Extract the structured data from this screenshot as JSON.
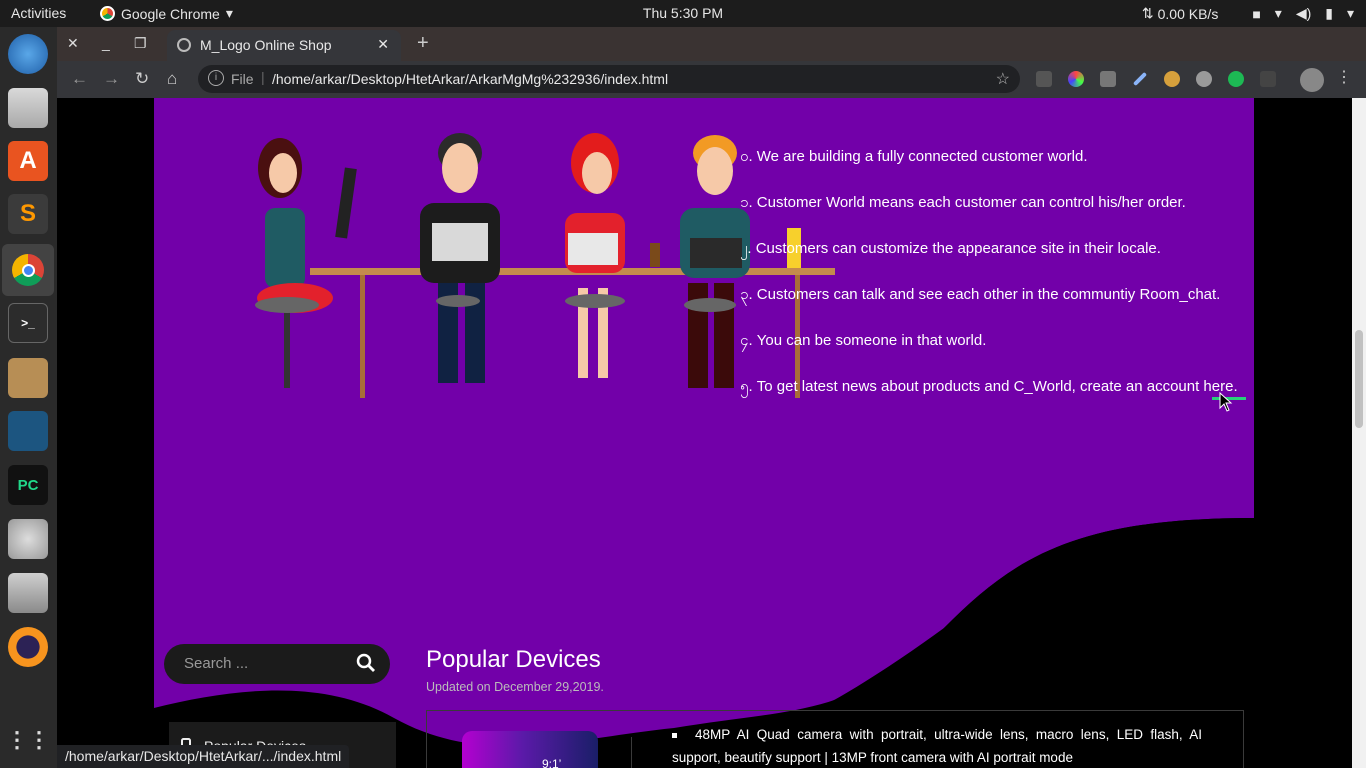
{
  "system": {
    "activities": "Activities",
    "app_name": "Google Chrome",
    "clock": "Thu  5:30 PM",
    "net_speed": "0.00 KB/s"
  },
  "dock": {
    "items": [
      "thunderbird-icon",
      "files-icon",
      "software-center-icon",
      "sublime-text-icon",
      "chrome-icon",
      "terminal-icon",
      "archive-manager-icon",
      "mysql-workbench-icon",
      "pycharm-icon",
      "cheese-icon",
      "database-icon",
      "eclipse-icon",
      "show-apps-icon"
    ],
    "pycharm_label": "PC",
    "terminal_label": ">_"
  },
  "browser": {
    "tab_title": "M_Logo Online Shop",
    "scheme": "File",
    "url": "/home/arkar/Desktop/HtetArkar/ArkarMgMg%232936/index.html",
    "status_url": "/home/arkar/Desktop/HtetArkar/.../index.html"
  },
  "features": [
    "၀. We are building a fully connected customer world.",
    "၁. Customer World means each customer can control his/her order.",
    "၂. Customers can customize the appearance site in their locale.",
    "၃. Customers can talk and see each other in the communtiy Room_chat.",
    "၄. You can be someone in that world.",
    "၅. To get latest news about products and C_World, create an account here."
  ],
  "sidebar": {
    "search_placeholder": "Search ...",
    "card_label": "Popular Devices"
  },
  "main": {
    "title": "Popular Devices",
    "updated": "Updated on December 29,2019.",
    "product_desc": "48MP AI Quad camera with portrait, ultra-wide lens, macro lens, LED flash, AI support, beautify support | 13MP front camera with AI portrait mode",
    "phone_time": "9:1’"
  },
  "colors": {
    "purple": "#7200a9",
    "black": "#000000",
    "link_underline": "#28d07a"
  }
}
